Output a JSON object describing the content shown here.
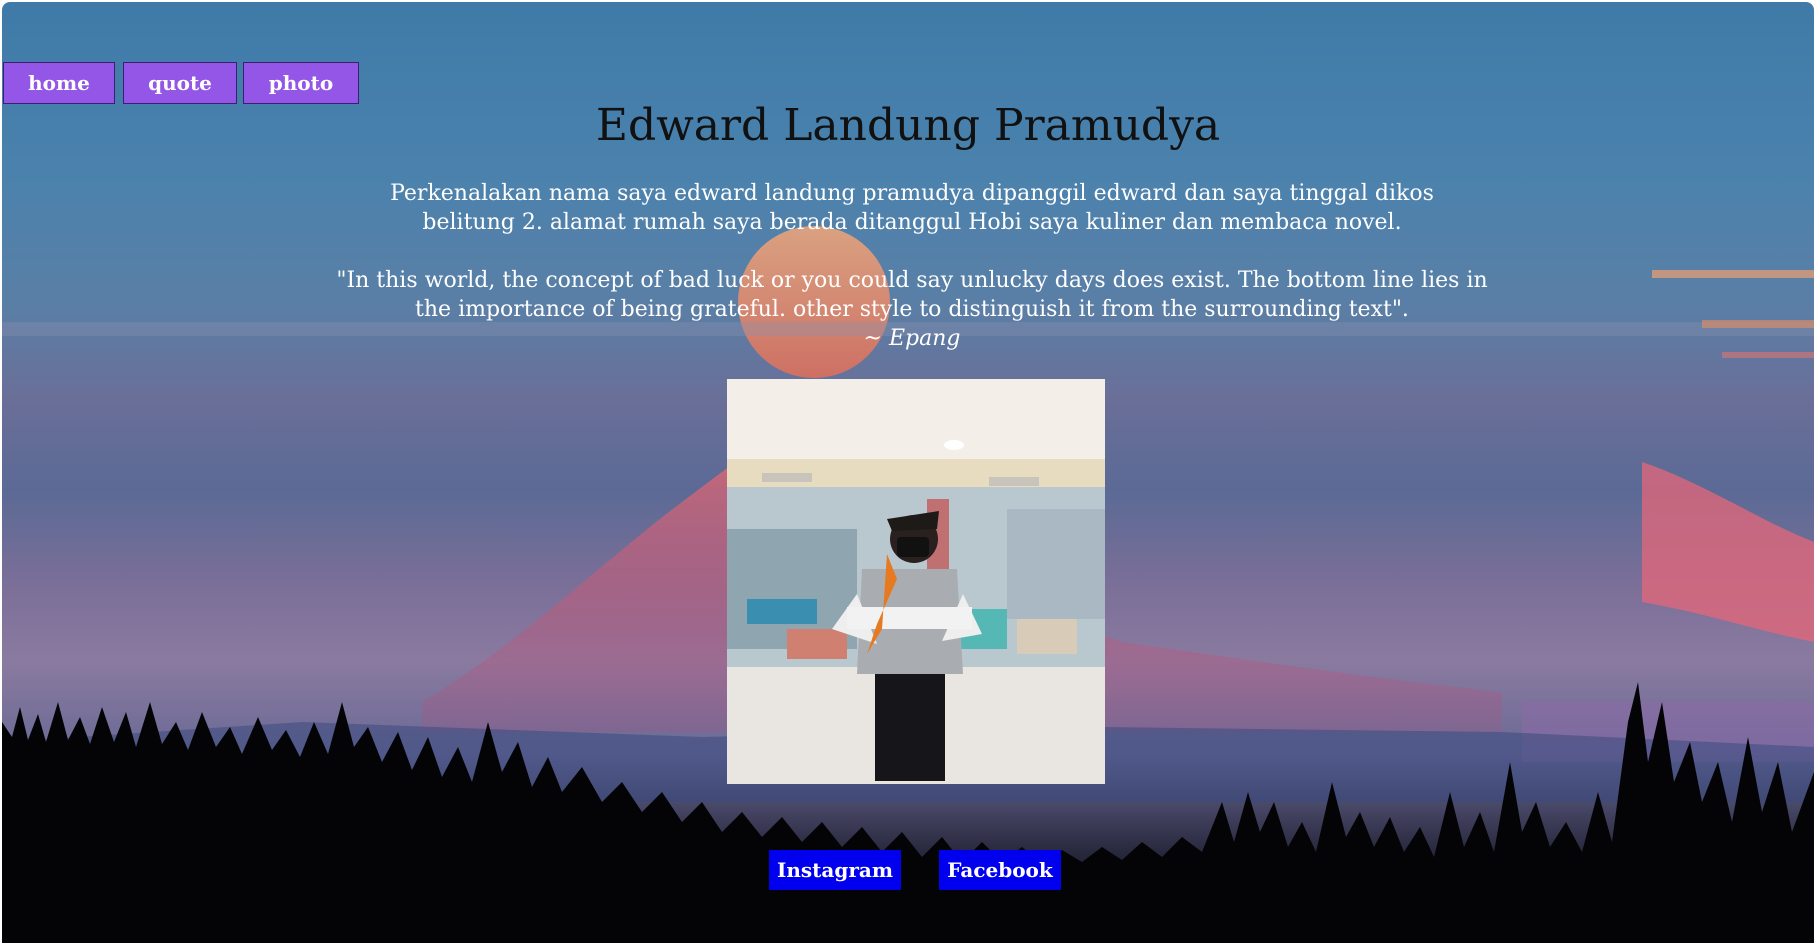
{
  "nav": {
    "home": "home",
    "quote": "quote",
    "photo": "photo"
  },
  "header": {
    "title": "Edward Landung Pramudya"
  },
  "intro": {
    "line1": "Perkenalakan nama saya edward landung pramudya dipanggil edward dan saya tinggal dikos",
    "line2": "belitung 2. alamat rumah saya berada ditanggul Hobi saya kuliner dan membaca novel."
  },
  "quote": {
    "line1": "\"In this world, the concept of bad luck or you could say unlucky days does exist. The bottom line lies in",
    "line2": "the importance of being grateful. other style to distinguish it from the surrounding text\".",
    "author_prefix": "~ ",
    "author": "Epang"
  },
  "social": {
    "instagram": "Instagram",
    "facebook": "Facebook"
  },
  "colors": {
    "nav_button": "#9456e6",
    "social_button": "#0000ee"
  }
}
